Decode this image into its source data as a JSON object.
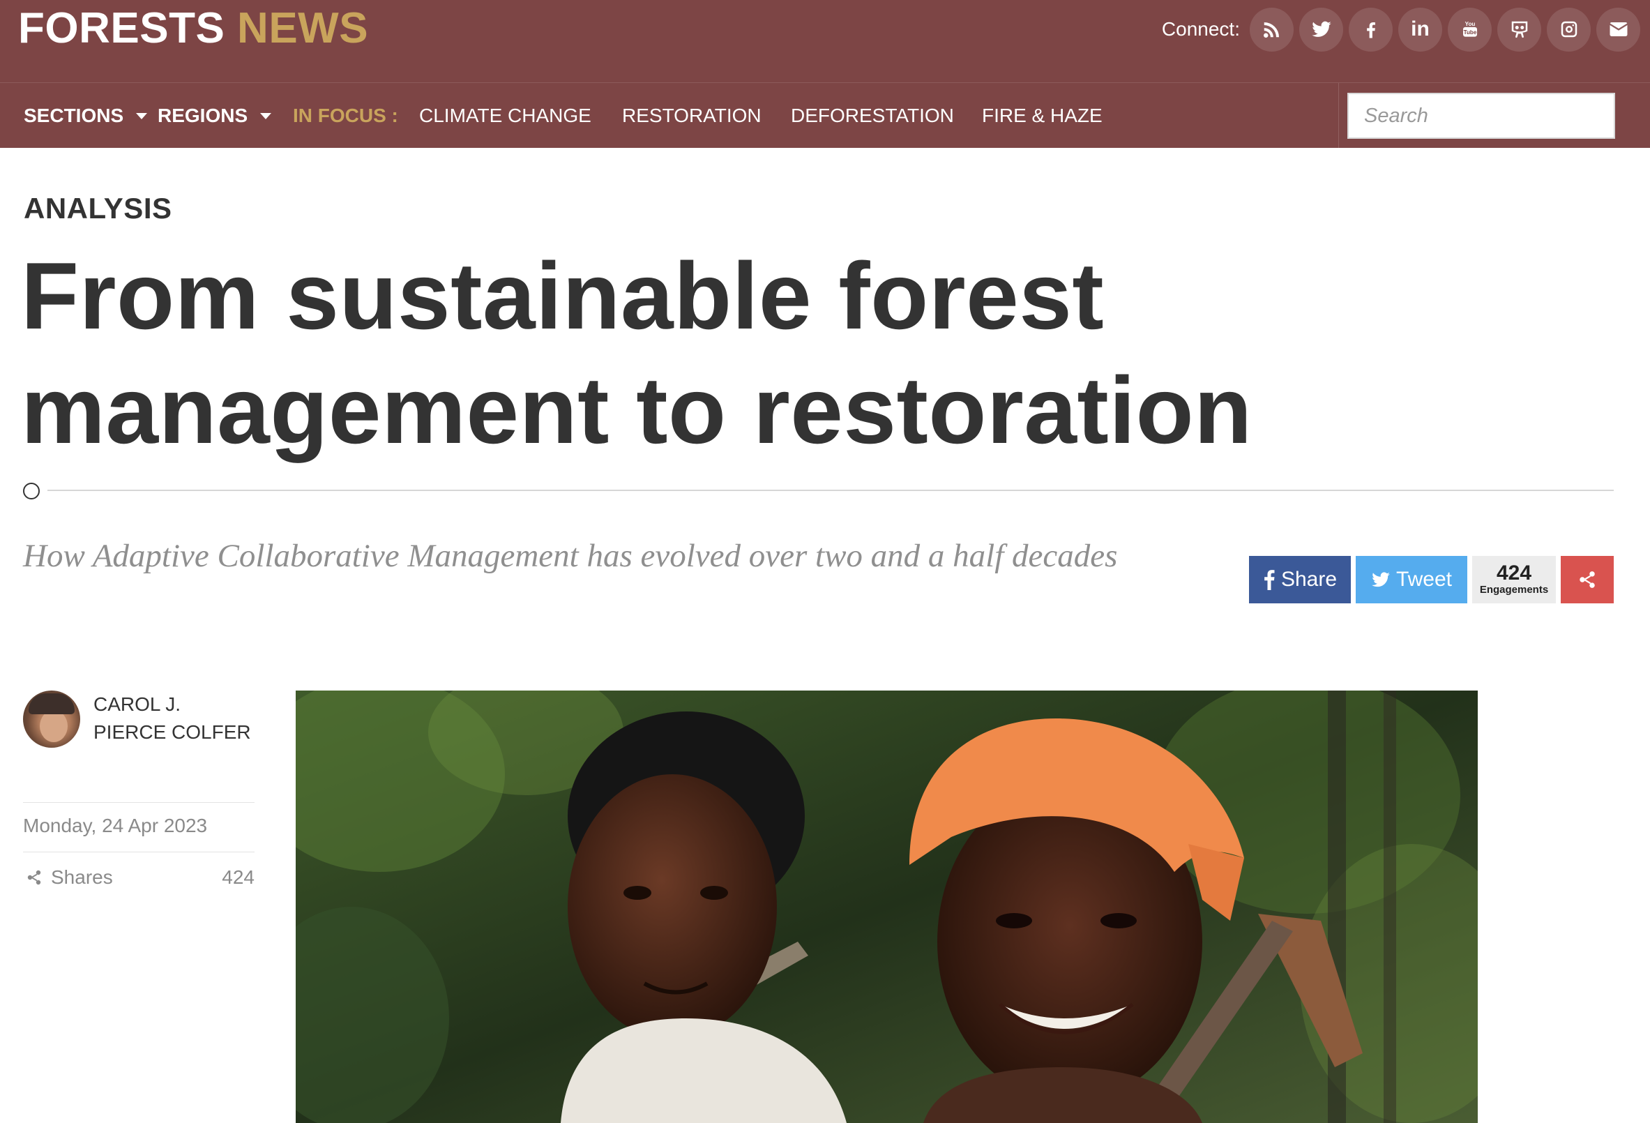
{
  "brand": {
    "word1": "FORESTS",
    "word2": "NEWS"
  },
  "connect": {
    "label": "Connect:",
    "icons": [
      "rss-icon",
      "twitter-icon",
      "facebook-icon",
      "linkedin-icon",
      "youtube-icon",
      "slideshare-icon",
      "instagram-icon",
      "email-icon"
    ],
    "linkedin_text": "in",
    "youtube_text_top": "You",
    "youtube_text_bottom": "Tube"
  },
  "nav": {
    "sections": "SECTIONS",
    "regions": "REGIONS",
    "in_focus": "IN FOCUS :",
    "links": [
      "CLIMATE CHANGE",
      "RESTORATION",
      "DEFORESTATION",
      "FIRE & HAZE"
    ]
  },
  "search": {
    "placeholder": "Search",
    "value": ""
  },
  "article": {
    "kicker": "ANALYSIS",
    "headline_line1": "From sustainable forest",
    "headline_line2": "management to restoration",
    "subhead": "How Adaptive Collaborative Management has evolved over two and a half decades"
  },
  "share": {
    "facebook_label": "Share",
    "twitter_label": "Tweet",
    "engagements_count": "424",
    "engagements_label": "Engagements"
  },
  "meta": {
    "author_line1": "CAROL J.",
    "author_line2": "PIERCE COLFER",
    "date": "Monday, 24 Apr 2023",
    "shares_label": "Shares",
    "shares_count": "424"
  },
  "colors": {
    "header_bg": "#7d4545",
    "brand_accent": "#c9a45c",
    "facebook": "#3b5998",
    "twitter": "#55acee",
    "share_more": "#d9534f"
  }
}
